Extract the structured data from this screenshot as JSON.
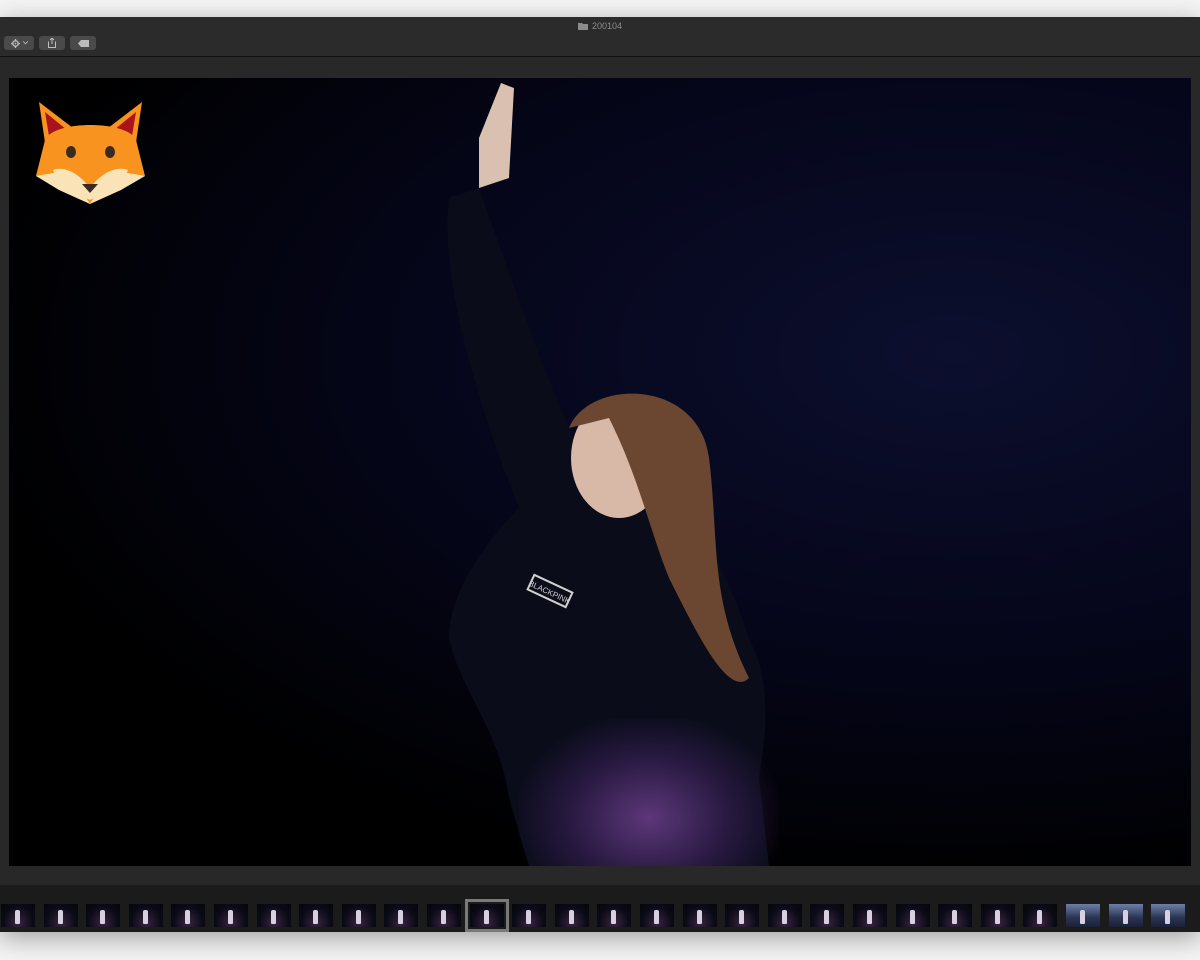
{
  "window": {
    "title": "200104"
  },
  "toolbar": {
    "buttons": [
      {
        "name": "action-menu-button",
        "icon": "gear-icon",
        "has_dropdown": true
      },
      {
        "name": "share-button",
        "icon": "share-icon"
      },
      {
        "name": "tag-button",
        "icon": "tag-icon"
      }
    ]
  },
  "viewer": {
    "overlay_logo": "fox-face-icon",
    "photo_sweatshirt_text": "BLACKPINK"
  },
  "filmstrip": {
    "thumbnail_count": 28,
    "selected_index": 11
  },
  "colors": {
    "window_bg": "#1e1e1e",
    "toolbar_bg": "#2b2b2b",
    "button_bg": "#4a4a4a",
    "fox_orange": "#f7931e"
  }
}
